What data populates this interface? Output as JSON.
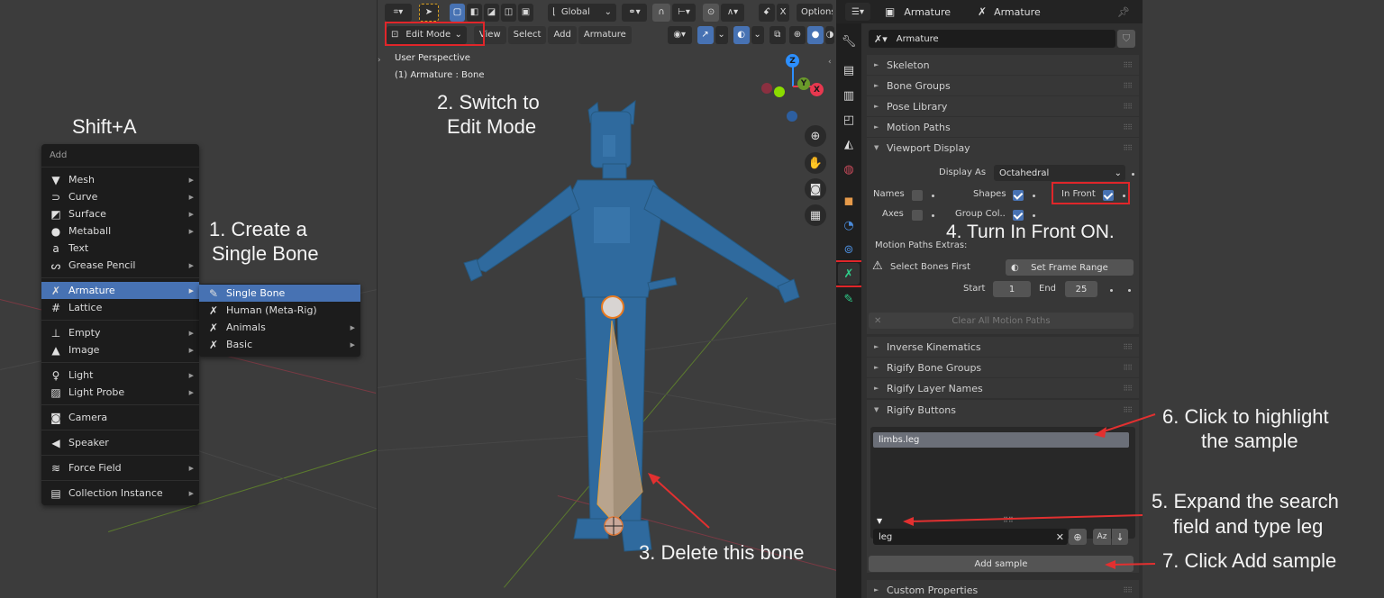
{
  "annotations": {
    "shortcut": "Shift+A",
    "step1_line1": "1. Create a",
    "step1_line2": "Single Bone",
    "step2_line1": "2. Switch to",
    "step2_line2": "Edit Mode",
    "step3": "3. Delete this bone",
    "step4": "4. Turn In Front ON.",
    "step5_line1": "5. Expand the search",
    "step5_line2": "field and type leg",
    "step6_line1": "6. Click to highlight",
    "step6_line2": "the sample",
    "step7": "7. Click Add sample"
  },
  "add_menu": {
    "title": "Add",
    "groups": [
      [
        {
          "label": "Mesh",
          "icon": "mesh-icon",
          "glyph": "▼",
          "submenu": true
        },
        {
          "label": "Curve",
          "icon": "curve-icon",
          "glyph": "⊃",
          "submenu": true
        },
        {
          "label": "Surface",
          "icon": "surface-icon",
          "glyph": "◩",
          "submenu": true
        },
        {
          "label": "Metaball",
          "icon": "metaball-icon",
          "glyph": "●",
          "submenu": true
        },
        {
          "label": "Text",
          "icon": "text-icon",
          "glyph": "a",
          "submenu": false
        },
        {
          "label": "Grease Pencil",
          "icon": "grease-pencil-icon",
          "glyph": "ᔕ",
          "submenu": true
        }
      ],
      [
        {
          "label": "Armature",
          "icon": "armature-icon",
          "glyph": "✗",
          "submenu": true,
          "active": true
        },
        {
          "label": "Lattice",
          "icon": "lattice-icon",
          "glyph": "#",
          "submenu": false
        }
      ],
      [
        {
          "label": "Empty",
          "icon": "empty-icon",
          "glyph": "⊥",
          "submenu": true
        },
        {
          "label": "Image",
          "icon": "image-icon",
          "glyph": "▲",
          "submenu": true
        }
      ],
      [
        {
          "label": "Light",
          "icon": "light-icon",
          "glyph": "♀",
          "submenu": true
        },
        {
          "label": "Light Probe",
          "icon": "light-probe-icon",
          "glyph": "▨",
          "submenu": true
        }
      ],
      [
        {
          "label": "Camera",
          "icon": "camera-icon",
          "glyph": "◙",
          "submenu": false
        }
      ],
      [
        {
          "label": "Speaker",
          "icon": "speaker-icon",
          "glyph": "◀",
          "submenu": false
        }
      ],
      [
        {
          "label": "Force Field",
          "icon": "force-field-icon",
          "glyph": "≋",
          "submenu": true
        }
      ],
      [
        {
          "label": "Collection Instance",
          "icon": "collection-instance-icon",
          "glyph": "▤",
          "submenu": true
        }
      ]
    ]
  },
  "armature_submenu": [
    {
      "label": "Single Bone",
      "icon": "bone-icon",
      "glyph": "✎",
      "submenu": false,
      "active": true
    },
    {
      "label": "Human (Meta-Rig)",
      "icon": "armature-icon",
      "glyph": "✗",
      "submenu": false
    },
    {
      "label": "Animals",
      "icon": "armature-icon",
      "glyph": "✗",
      "submenu": true
    },
    {
      "label": "Basic",
      "icon": "armature-icon",
      "glyph": "✗",
      "submenu": true
    }
  ],
  "viewport": {
    "transform_orientation": "Global",
    "options_label": "Options",
    "mode": "Edit Mode",
    "menus": [
      "View",
      "Select",
      "Add",
      "Armature"
    ],
    "perspective": "User Perspective",
    "active_object": "(1) Armature : Bone",
    "gizmo_axes": [
      "X",
      "Y",
      "Z"
    ],
    "colors": {
      "x": "#e8384f",
      "y": "#8bdc00",
      "z": "#2c8fff",
      "bone": "#b8a48e",
      "mesh": "#2f6a9e"
    }
  },
  "properties": {
    "header_object": "Armature",
    "header_data": "Armature",
    "datablock_name": "Armature",
    "collapsed_panels_top": [
      "Skeleton",
      "Bone Groups",
      "Pose Library",
      "Motion Paths"
    ],
    "viewport_display": {
      "title": "Viewport Display",
      "display_as_label": "Display As",
      "display_as_value": "Octahedral",
      "names_label": "Names",
      "names_checked": false,
      "shapes_label": "Shapes",
      "shapes_checked": true,
      "in_front_label": "In Front",
      "in_front_checked": true,
      "axes_label": "Axes",
      "axes_checked": false,
      "group_colors_label": "Group Col..",
      "group_colors_checked": true,
      "motion_paths_extras_label": "Motion Paths Extras:",
      "warning_text": "Select Bones First",
      "set_frame_range_label": "Set Frame Range",
      "start_label": "Start",
      "start_value": "1",
      "end_label": "End",
      "end_value": "25",
      "clear_label": "Clear All Motion Paths"
    },
    "collapsed_panels_bottom": [
      "Inverse Kinematics",
      "Rigify Bone Groups",
      "Rigify Layer Names"
    ],
    "rigify_buttons": {
      "title": "Rigify Buttons",
      "list_items": [
        "limbs.leg"
      ],
      "search_value": "leg",
      "add_sample_label": "Add sample"
    },
    "custom_properties": "Custom Properties"
  },
  "accent": {
    "highlight_blue": "#4772b3",
    "annotation_red": "#e0262a"
  }
}
